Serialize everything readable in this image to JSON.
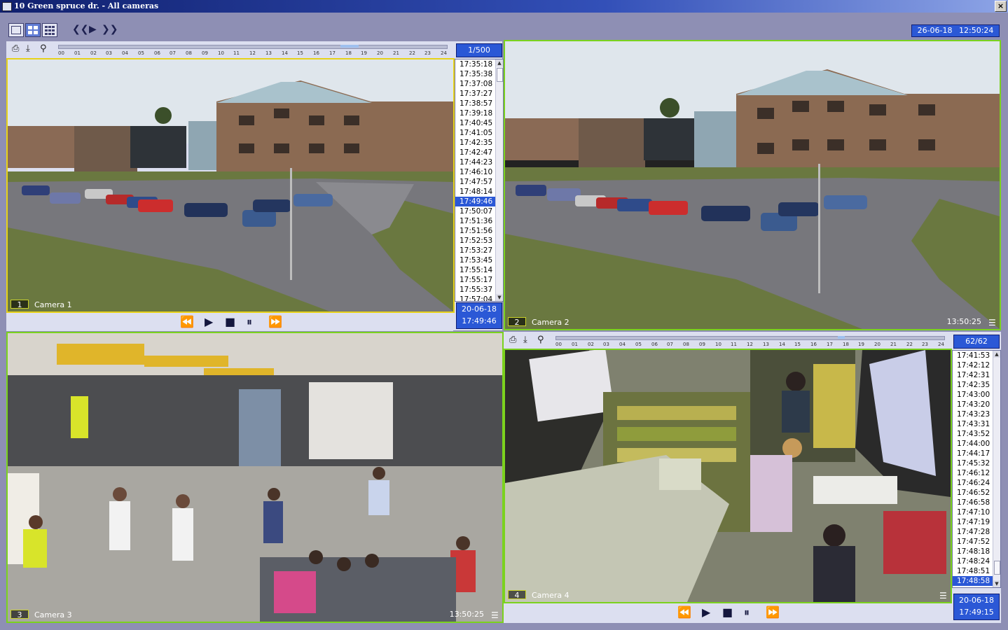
{
  "window": {
    "title": "10 Green spruce dr. - All cameras",
    "close_label": "×"
  },
  "toolbar": {
    "nav_icons": [
      "rewind-double-icon",
      "play-icon",
      "forward-double-icon"
    ],
    "date": "26-06-18",
    "time": "12:50:24"
  },
  "timeline_ticks": [
    "00",
    "01",
    "02",
    "03",
    "04",
    "05",
    "06",
    "07",
    "08",
    "09",
    "10",
    "11",
    "12",
    "13",
    "14",
    "15",
    "16",
    "17",
    "18",
    "19",
    "20",
    "21",
    "22",
    "23",
    "24"
  ],
  "cameras": [
    {
      "num": "1",
      "name": "Camera 1",
      "counter": "1/500",
      "times": [
        "17:35:18",
        "17:35:38",
        "17:37:08",
        "17:37:27",
        "17:38:57",
        "17:39:18",
        "17:40:45",
        "17:41:05",
        "17:42:35",
        "17:42:47",
        "17:44:23",
        "17:46:10",
        "17:47:57",
        "17:48:14",
        "17:49:46",
        "17:50:07",
        "17:51:36",
        "17:51:56",
        "17:52:53",
        "17:53:27",
        "17:53:45",
        "17:55:14",
        "17:55:17",
        "17:55:37",
        "17:57:04"
      ],
      "selected_index": 14,
      "date": "20-06-18",
      "time": "17:49:46"
    },
    {
      "num": "2",
      "name": "Camera 2",
      "live_time": "13:50:25"
    },
    {
      "num": "3",
      "name": "Camera 3",
      "live_time": "13:50:25"
    },
    {
      "num": "4",
      "name": "Camera 4",
      "counter": "62/62",
      "times": [
        "17:41:53",
        "17:42:12",
        "17:42:31",
        "17:42:35",
        "17:43:00",
        "17:43:20",
        "17:43:23",
        "17:43:31",
        "17:43:52",
        "17:44:00",
        "17:44:17",
        "17:45:32",
        "17:46:12",
        "17:46:24",
        "17:46:52",
        "17:46:58",
        "17:47:10",
        "17:47:19",
        "17:47:28",
        "17:47:52",
        "17:48:18",
        "17:48:24",
        "17:48:51",
        "17:48:58"
      ],
      "selected_index": 23,
      "date": "20-06-18",
      "time": "17:49:15"
    }
  ],
  "colors": {
    "accent": "#2b58d6",
    "active_border": "#7bd21e",
    "selected_border": "#e7d21a",
    "background": "#8e8fb4"
  }
}
